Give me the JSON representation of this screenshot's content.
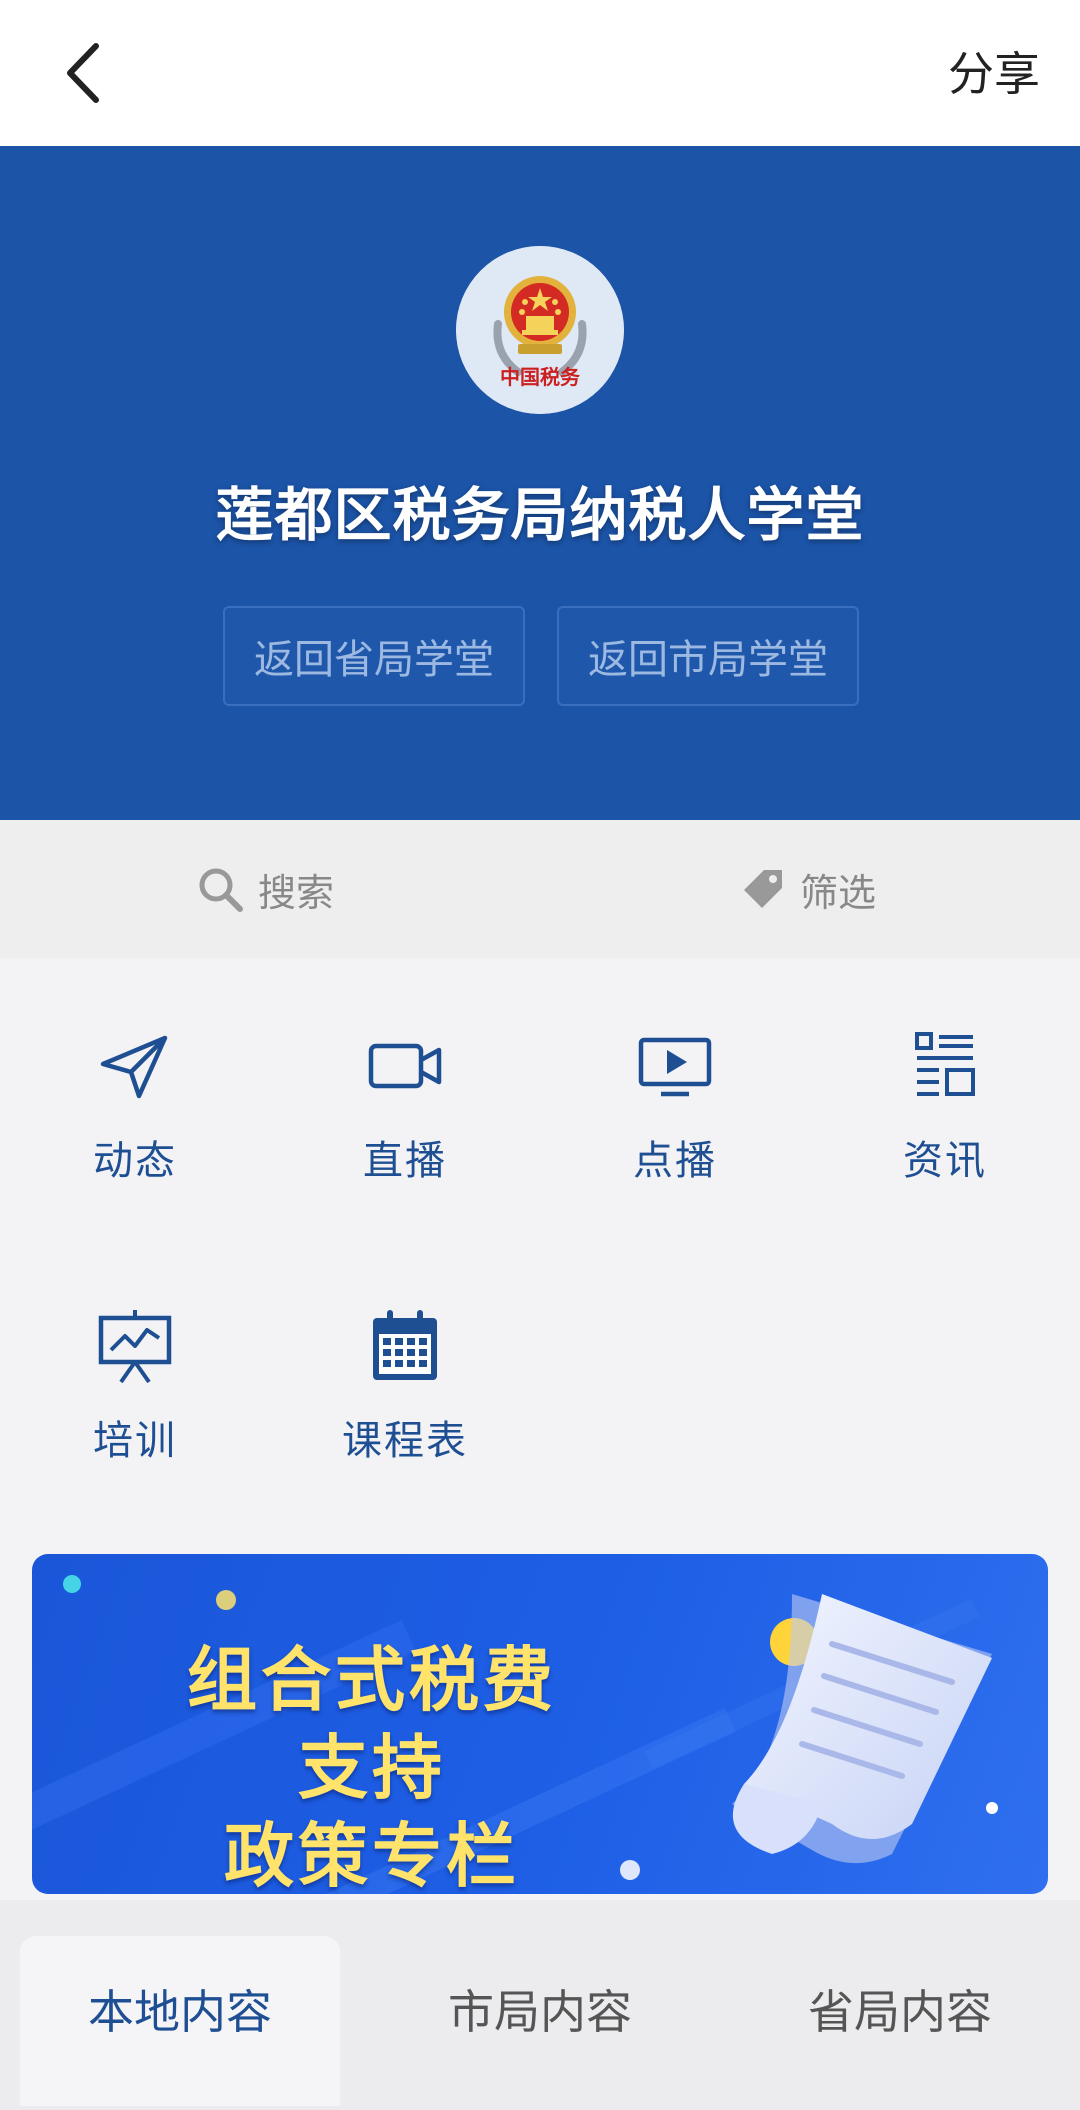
{
  "topbar": {
    "back_icon": "chevron-left-icon",
    "share_label": "分享"
  },
  "hero": {
    "logo_text": "中国税务",
    "title": "莲都区税务局纳税人学堂",
    "btn_province": "返回省局学堂",
    "btn_city": "返回市局学堂",
    "bg_color": "#1c54a8"
  },
  "filterbar": {
    "search_label": "搜索",
    "filter_label": "筛选"
  },
  "grid": {
    "items": [
      {
        "label": "动态",
        "icon": "paper-plane-icon"
      },
      {
        "label": "直播",
        "icon": "video-camera-icon"
      },
      {
        "label": "点播",
        "icon": "play-screen-icon"
      },
      {
        "label": "资讯",
        "icon": "news-list-icon"
      },
      {
        "label": "培训",
        "icon": "presentation-board-icon"
      },
      {
        "label": "课程表",
        "icon": "calendar-icon"
      }
    ],
    "accent_color": "#1f4f93"
  },
  "banner": {
    "line1": "组合式税费支持",
    "line2": "政策专栏"
  },
  "tabs": {
    "items": [
      "本地内容",
      "市局内容",
      "省局内容"
    ],
    "active": "本地内容"
  }
}
